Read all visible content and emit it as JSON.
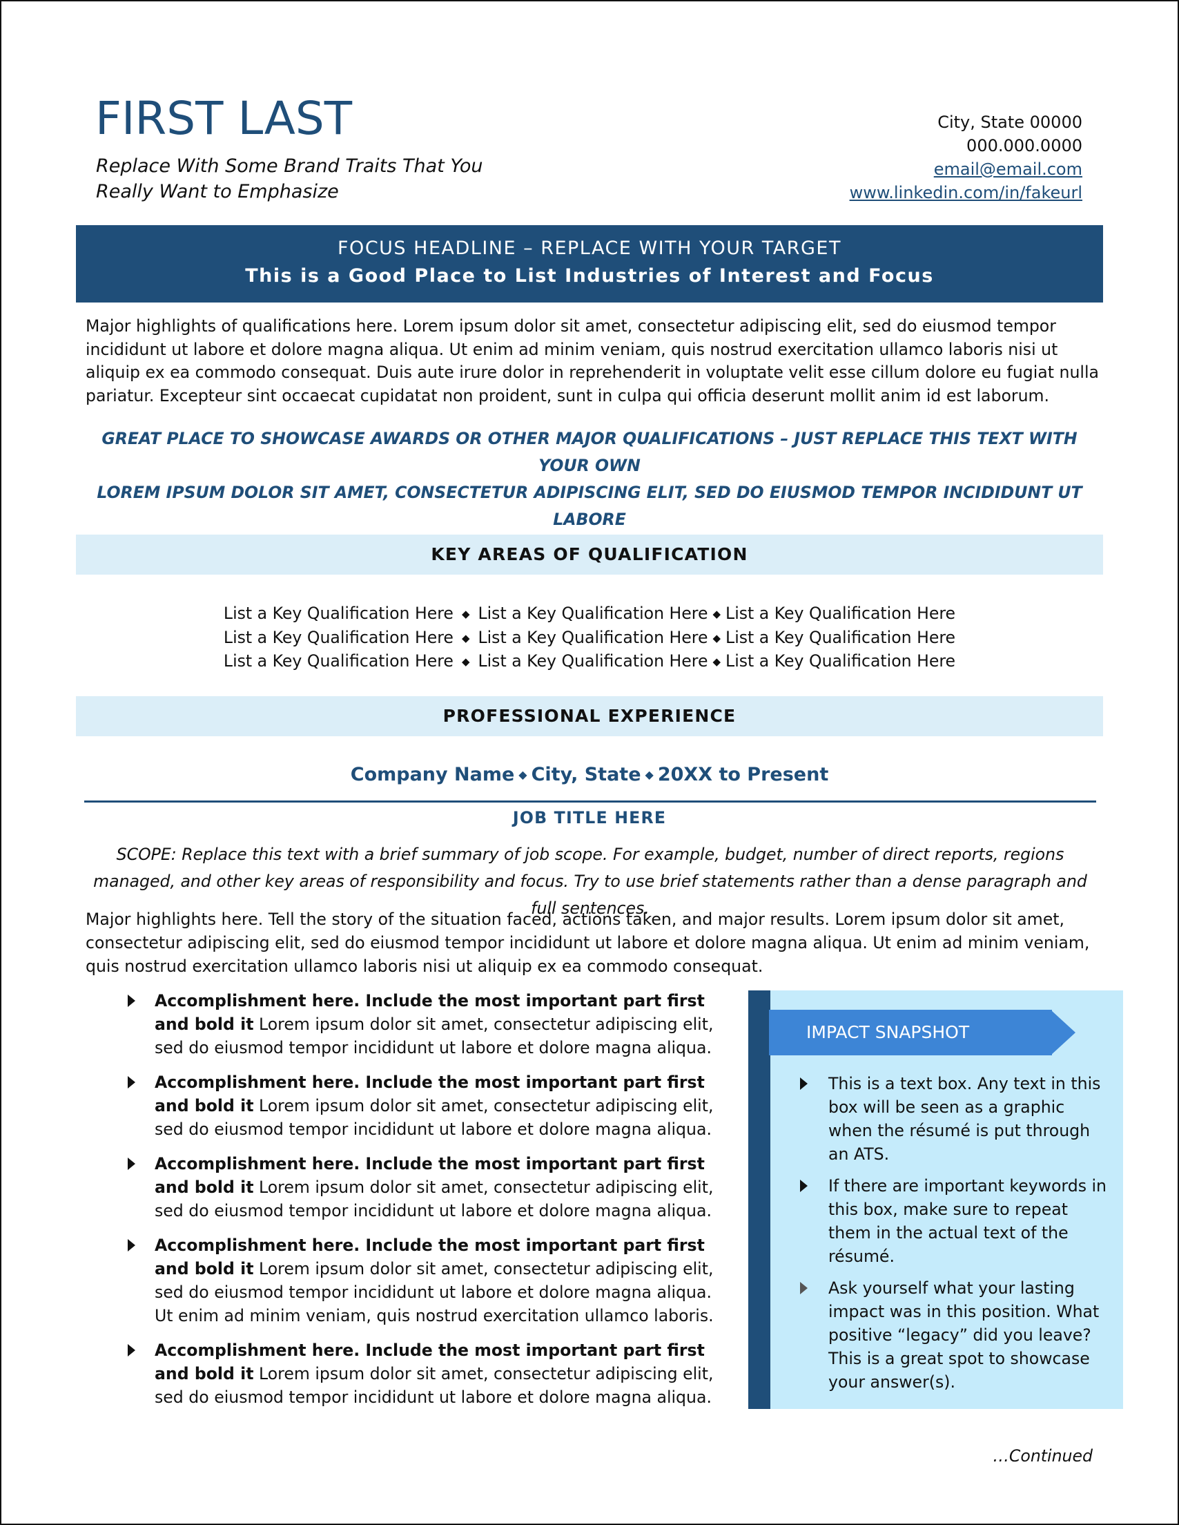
{
  "header": {
    "name": "FIRST LAST",
    "brand_lines": [
      "Replace With Some Brand Traits That You",
      "Really Want to Emphasize"
    ],
    "contact": {
      "location": "City, State 00000",
      "phone": "000.000.0000",
      "email": "email@email.com",
      "linkedin": "www.linkedin.com/in/fakeurl"
    }
  },
  "focus": {
    "headline": "FOCUS HEADLINE – REPLACE WITH YOUR TARGET",
    "subheadline": "This is a Good Place to List Industries of Interest and Focus"
  },
  "summary": "Major highlights of qualifications here. Lorem ipsum dolor sit amet, consectetur adipiscing elit, sed do eiusmod tempor incididunt ut labore et dolore magna aliqua. Ut enim ad minim veniam, quis nostrud exercitation ullamco laboris nisi ut aliquip ex ea commodo consequat. Duis aute irure dolor in reprehenderit in voluptate velit esse cillum dolore eu fugiat nulla pariatur. Excepteur sint occaecat cupidatat non proident, sunt in culpa qui officia deserunt mollit anim id est laborum.",
  "awards": [
    "GREAT PLACE TO SHOWCASE AWARDS OR OTHER MAJOR QUALIFICATIONS – JUST REPLACE THIS TEXT WITH YOUR OWN",
    "LOREM IPSUM DOLOR SIT AMET, CONSECTETUR ADIPISCING ELIT, SED DO EIUSMOD TEMPOR INCIDIDUNT UT LABORE",
    "LOREM IPSUM DOLOR SIT AMET, CONSECTETUR ADIPISCING ELIT, SED DO EIUSMOD TEMPOR INCIDIDUNT"
  ],
  "key_areas": {
    "title": "KEY AREAS OF QUALIFICATION",
    "separator": "◆",
    "rows": [
      [
        "List a Key Qualification Here",
        "List a Key Qualification Here",
        "List a Key Qualification Here"
      ],
      [
        "List a Key Qualification Here",
        "List a Key Qualification Here",
        "List a Key Qualification Here"
      ],
      [
        "List a Key Qualification Here",
        "List a Key Qualification Here",
        "List a Key Qualification Here"
      ]
    ]
  },
  "experience": {
    "title": "PROFESSIONAL EXPERIENCE",
    "company": "Company Name",
    "location": "City, State",
    "dates": "20XX to Present",
    "separator": "◆",
    "job_title": "JOB TITLE HERE",
    "scope": "SCOPE: Replace this text with a brief summary of job scope. For example, budget, number of direct reports, regions managed, and other key areas of responsibility and focus. Try to use brief statements rather than a dense paragraph and full sentences.",
    "highlights": "Major highlights here. Tell the story of the situation faced, actions taken, and major results. Lorem ipsum dolor sit amet, consectetur adipiscing elit, sed do eiusmod tempor incididunt ut labore et dolore magna aliqua. Ut enim ad minim veniam, quis nostrud exercitation ullamco laboris nisi ut aliquip ex ea commodo consequat.",
    "accomplishments": [
      {
        "bold": "Accomplishment here. Include the most important part first and bold it",
        "text": " Lorem ipsum dolor sit amet, consectetur adipiscing elit, sed do eiusmod tempor incididunt ut labore et dolore magna aliqua."
      },
      {
        "bold": "Accomplishment here. Include the most important part first and bold it",
        "text": " Lorem ipsum dolor sit amet, consectetur adipiscing elit, sed do eiusmod tempor incididunt ut labore et dolore magna aliqua."
      },
      {
        "bold": "Accomplishment here. Include the most important part first and bold it",
        "text": " Lorem ipsum dolor sit amet, consectetur adipiscing elit, sed do eiusmod tempor incididunt ut labore et dolore magna aliqua."
      },
      {
        "bold": "Accomplishment here. Include the most important part first and bold it",
        "text": " Lorem ipsum dolor sit amet, consectetur adipiscing elit, sed do eiusmod tempor incididunt ut labore et dolore magna aliqua. Ut enim ad minim veniam, quis nostrud exercitation ullamco laboris."
      },
      {
        "bold": "Accomplishment here. Include the most important part first and bold it",
        "text": " Lorem ipsum dolor sit amet, consectetur adipiscing elit, sed do eiusmod tempor incididunt ut labore et dolore magna aliqua."
      }
    ]
  },
  "impact_snapshot": {
    "title": "IMPACT SNAPSHOT",
    "items": [
      "This is a text box. Any text in this box will be seen as a graphic when the résumé is put through an ATS.",
      "If there are important keywords in this box, make sure to repeat them in the actual text of the résumé.",
      "Ask yourself what your lasting impact was in this position. What positive “legacy” did you leave? This is a great spot to showcase your answer(s)."
    ]
  },
  "footer": {
    "continued": "…Continued"
  },
  "colors": {
    "primary": "#1f4e79",
    "section_bg": "#dbeef8",
    "snapshot_bg": "#c5ebfb",
    "snapshot_banner": "#3d85d6"
  }
}
